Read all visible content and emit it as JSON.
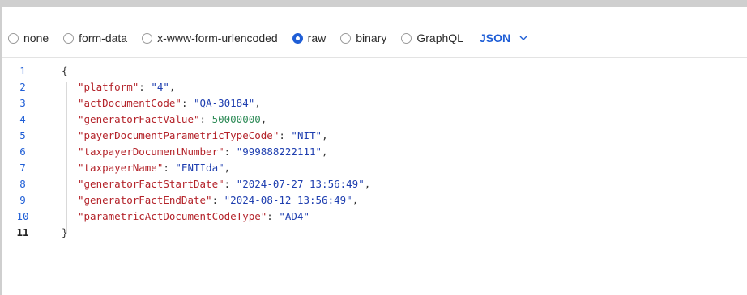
{
  "body_types": [
    {
      "label": "none",
      "selected": false
    },
    {
      "label": "form-data",
      "selected": false
    },
    {
      "label": "x-www-form-urlencoded",
      "selected": false
    },
    {
      "label": "raw",
      "selected": true
    },
    {
      "label": "binary",
      "selected": false
    },
    {
      "label": "GraphQL",
      "selected": false
    }
  ],
  "language": {
    "label": "JSON",
    "icon": "chevron-down-icon"
  },
  "editor": {
    "line_numbers": [
      "1",
      "2",
      "3",
      "4",
      "5",
      "6",
      "7",
      "8",
      "9",
      "10",
      "11"
    ],
    "open_brace": "{",
    "close_brace": "}",
    "lines": [
      {
        "key": "\"platform\"",
        "value": "\"4\"",
        "type": "string",
        "trail": ","
      },
      {
        "key": "\"actDocumentCode\"",
        "value": "\"QA-30184\"",
        "type": "string",
        "trail": ","
      },
      {
        "key": "\"generatorFactValue\"",
        "value": "50000000",
        "type": "number",
        "trail": ","
      },
      {
        "key": "\"payerDocumentParametricTypeCode\"",
        "value": "\"NIT\"",
        "type": "string",
        "trail": ","
      },
      {
        "key": "\"taxpayerDocumentNumber\"",
        "value": "\"999888222111\"",
        "type": "string",
        "trail": ","
      },
      {
        "key": "\"taxpayerName\"",
        "value": "\"ENTIda\"",
        "type": "string",
        "trail": ","
      },
      {
        "key": "\"generatorFactStartDate\"",
        "value": "\"2024-07-27 13:56:49\"",
        "type": "string",
        "trail": ","
      },
      {
        "key": "\"generatorFactEndDate\"",
        "value": "\"2024-08-12 13:56:49\"",
        "type": "string",
        "trail": ","
      },
      {
        "key": "\"parametricActDocumentCodeType\"",
        "value": "\"AD4\"",
        "type": "string",
        "trail": ""
      }
    ]
  },
  "colors": {
    "accent": "#1f5ed6",
    "json_key": "#b4232a",
    "json_string": "#1f3fb0",
    "json_number": "#2e8b57"
  }
}
